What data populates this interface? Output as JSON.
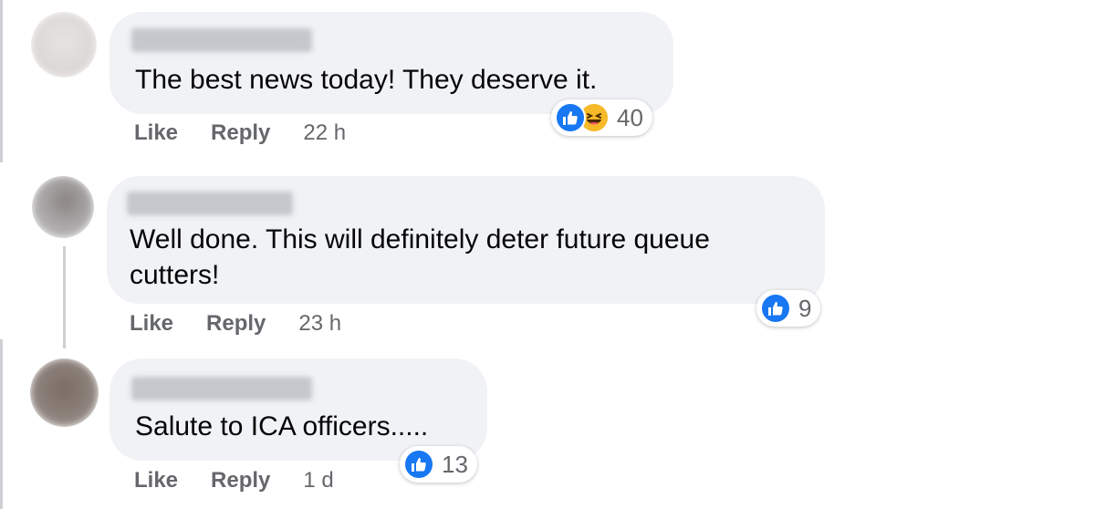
{
  "comments": [
    {
      "text": "The best news today! They deserve it.",
      "actions": {
        "like": "Like",
        "reply": "Reply",
        "time": "22 h"
      },
      "reactions": {
        "types": [
          "like-icon",
          "haha-icon"
        ],
        "count": "40"
      }
    },
    {
      "text_line1": "Well done. This will definitely deter future queue",
      "text_line2": "cutters!",
      "actions": {
        "like": "Like",
        "reply": "Reply",
        "time": "23 h"
      },
      "reactions": {
        "types": [
          "like-icon"
        ],
        "count": "9"
      }
    },
    {
      "text": "Salute to ICA officers.....",
      "actions": {
        "like": "Like",
        "reply": "Reply",
        "time": "1 d"
      },
      "reactions": {
        "types": [
          "like-icon"
        ],
        "count": "13"
      }
    }
  ],
  "colors": {
    "bubble": "#f0f2f5",
    "like_blue": "#1877f2",
    "haha_yellow": "#f7b928",
    "meta_grey": "#65676b"
  }
}
